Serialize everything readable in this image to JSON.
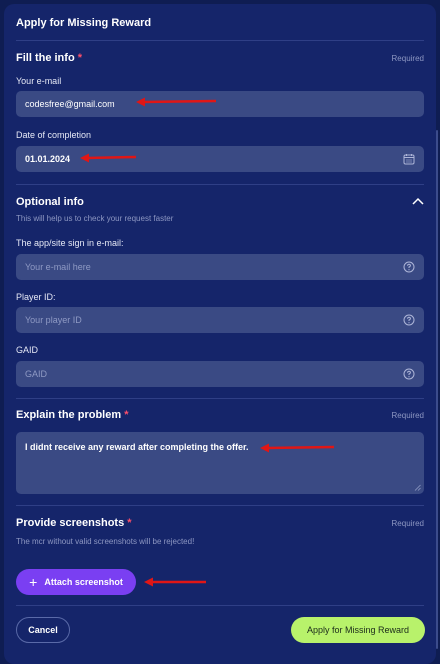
{
  "modal": {
    "title": "Apply for Missing Reward"
  },
  "fill_info": {
    "title": "Fill the info",
    "star": "*",
    "required": "Required",
    "email_label": "Your e-mail",
    "email_value": "codesfree@gmail.com",
    "date_label": "Date of completion",
    "date_value": "01.01.2024"
  },
  "optional_info": {
    "title": "Optional info",
    "subtitle": "This will help us to check your request faster",
    "app_email_label": "The app/site sign in e-mail:",
    "app_email_placeholder": "Your e-mail here",
    "player_id_label": "Player ID:",
    "player_id_placeholder": "Your player ID",
    "gaid_label": "GAID",
    "gaid_placeholder": "GAID"
  },
  "problem": {
    "title": "Explain the problem",
    "star": "*",
    "required": "Required",
    "text": "I didnt receive any reward after completing the offer."
  },
  "screenshots": {
    "title": "Provide screenshots",
    "star": "*",
    "required": "Required",
    "note": "The mcr without valid screenshots will be rejected!",
    "attach_label": "Attach screenshot"
  },
  "footer": {
    "cancel_label": "Cancel",
    "submit_label": "Apply for Missing Reward"
  },
  "colors": {
    "background": "#15256a",
    "field": "#3a4a84",
    "accent_purple": "#7a3ff2",
    "accent_green": "#b8f26b",
    "required_star": "#ff4f6a",
    "annotation_arrow": "#e01616"
  },
  "icons": [
    "help-circle-icon",
    "calendar-icon",
    "chevron-up-icon",
    "plus-icon",
    "resize-grip-icon"
  ]
}
